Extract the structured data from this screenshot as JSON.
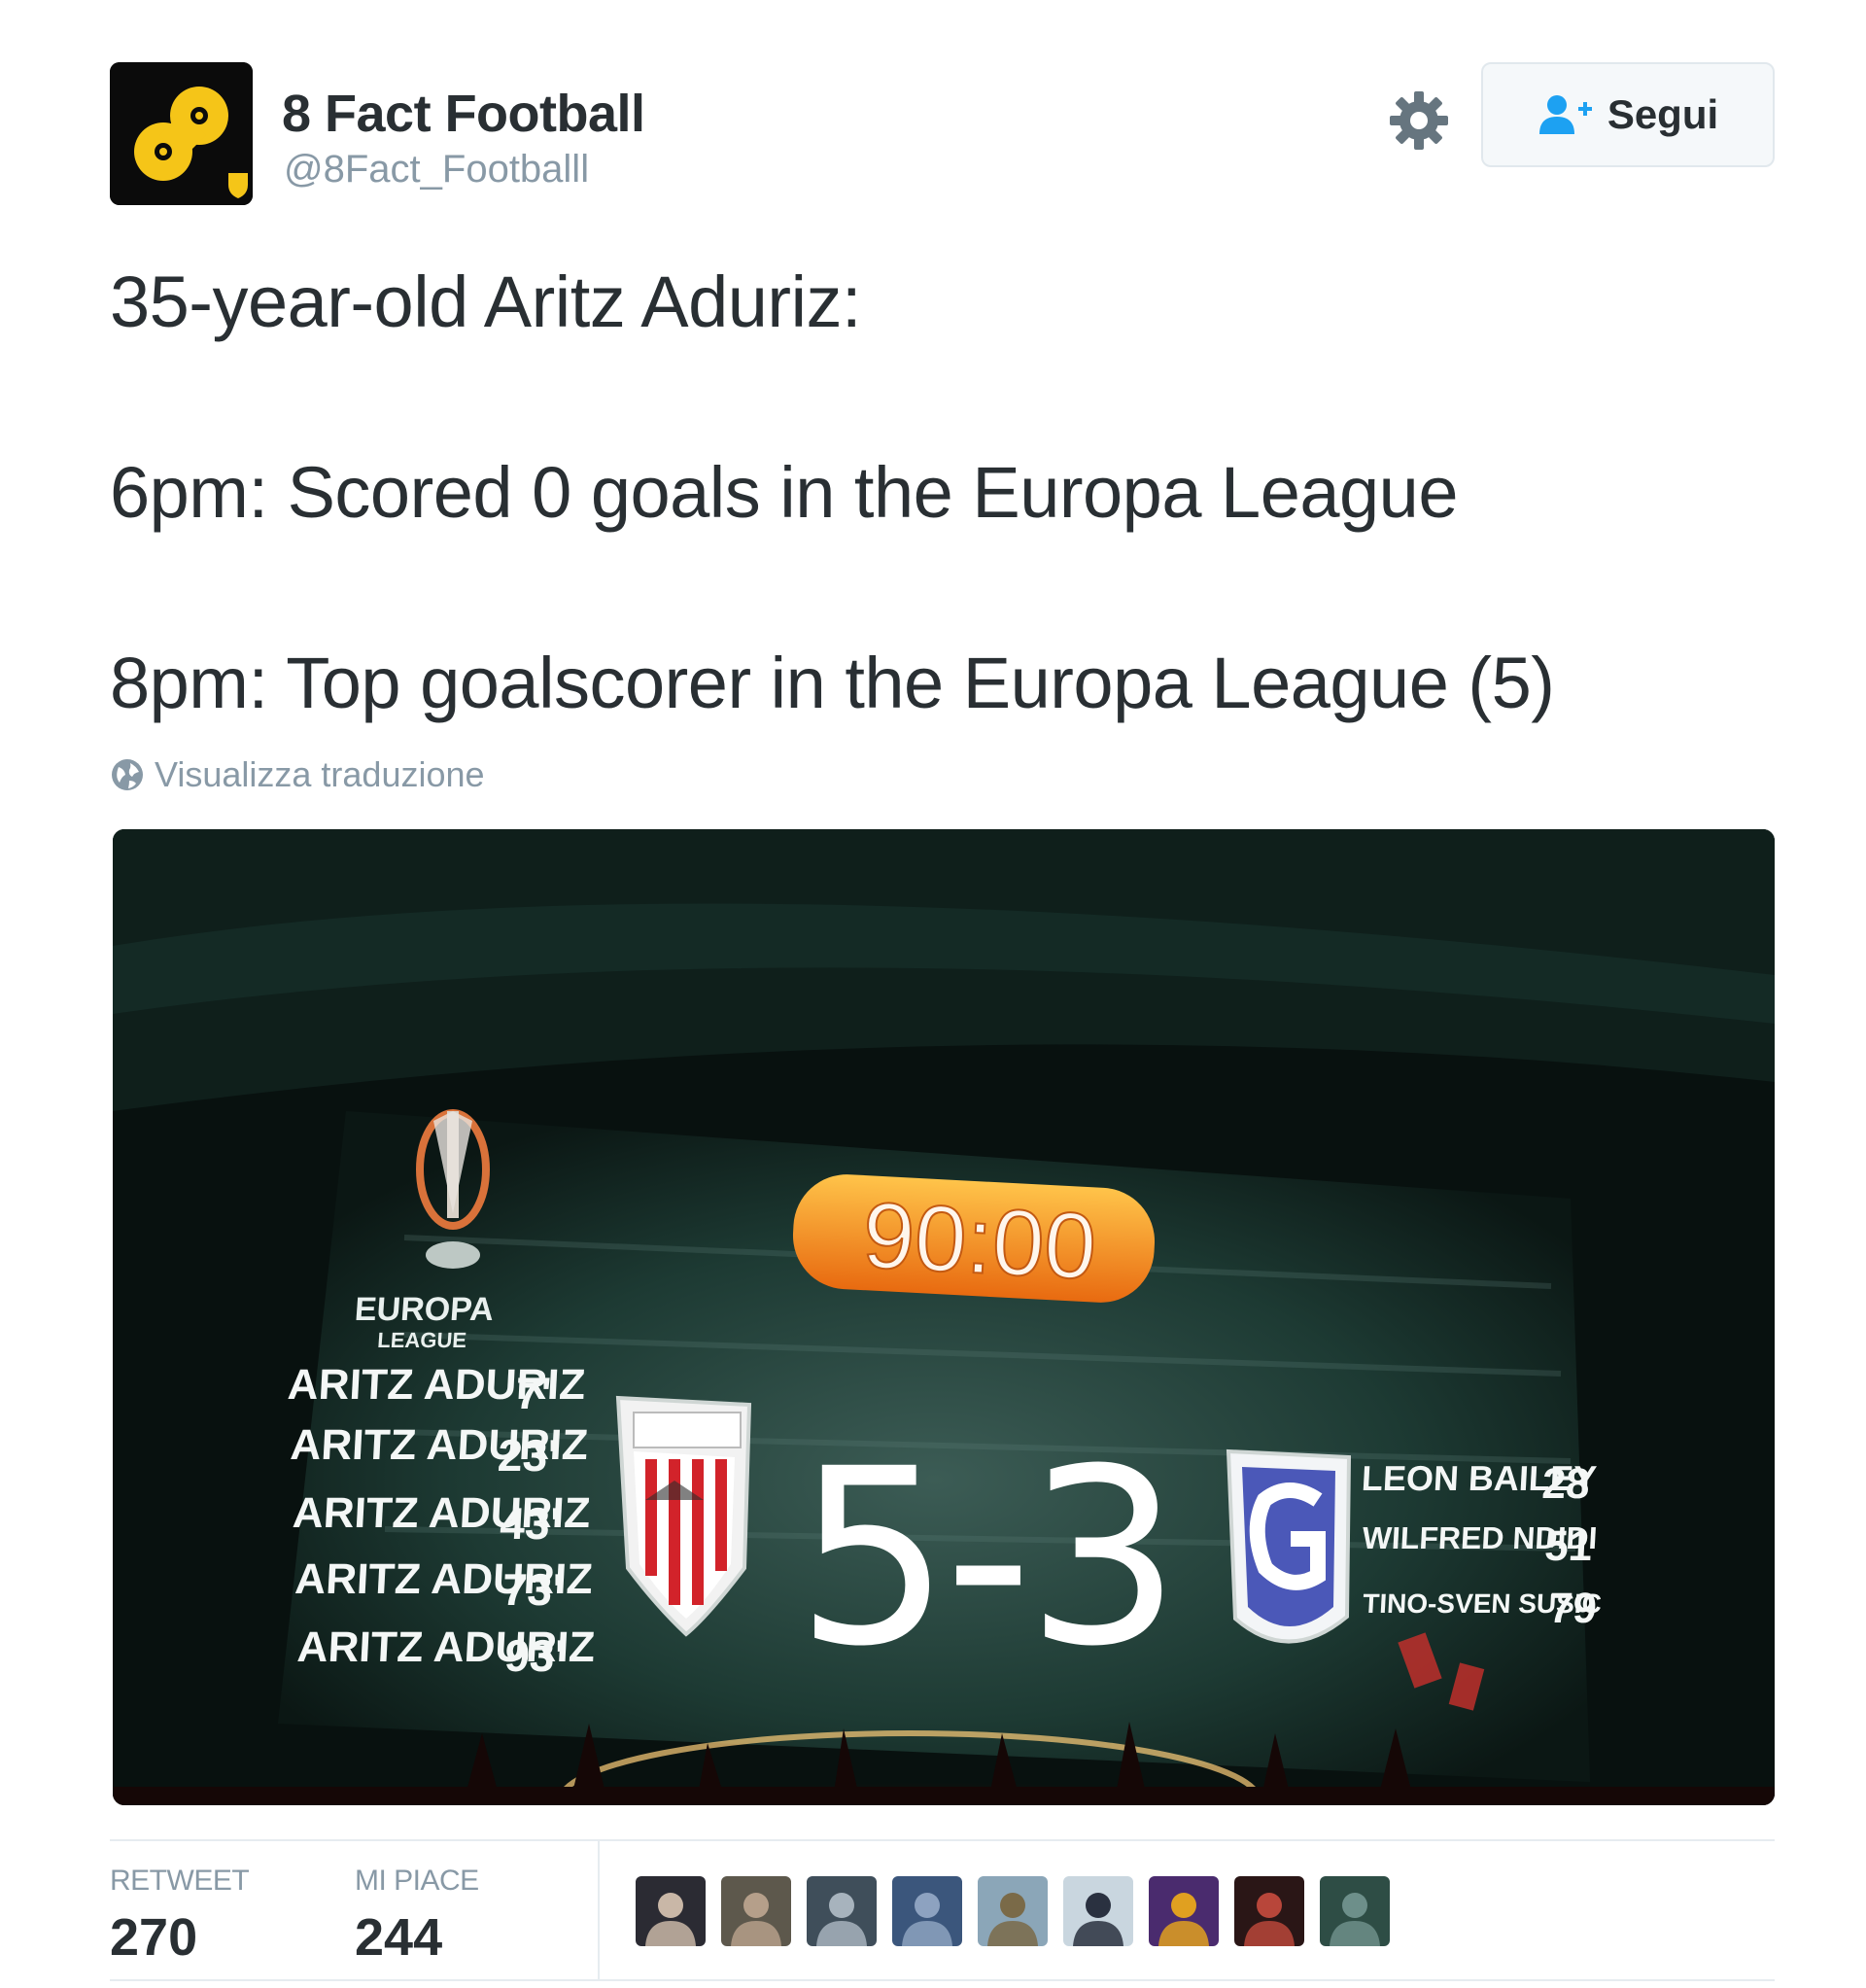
{
  "account": {
    "name": "8 Fact Football",
    "handle": "@8Fact_Footballl",
    "follow_label": "Segui",
    "avatar_colors": {
      "background": "#0b0b0b",
      "logo": "#f5c518"
    }
  },
  "tweet": {
    "lines": [
      "35-year-old Aritz Aduriz:",
      "6pm: Scored 0 goals in the Europa League",
      "8pm: Top goalscorer in the Europa League (5)"
    ],
    "translate_label": "Visualizza traduzione"
  },
  "media": {
    "clock": "90:00",
    "score": "5-3",
    "competition_lines": [
      "EUROPA",
      "LEAGUE"
    ],
    "home_scorers": [
      {
        "name": "ARITZ ADURIZ",
        "minute": "7'"
      },
      {
        "name": "ARITZ ADURIZ",
        "minute": "23'"
      },
      {
        "name": "ARITZ ADURIZ",
        "minute": "43'"
      },
      {
        "name": "ARITZ ADURIZ",
        "minute": "73'"
      },
      {
        "name": "ARITZ ADURIZ",
        "minute": "93'"
      }
    ],
    "away_scorers": [
      {
        "name": "LEON BAILEY",
        "minute": "28"
      },
      {
        "name": "WILFRED NDIDI",
        "minute": "51"
      },
      {
        "name": "TINO-SVEN SUSIC",
        "minute": "79"
      }
    ],
    "colors": {
      "clock_orange": "#f07a1c",
      "board_bg": "#1d3a33",
      "flames": "#ff6a1a"
    }
  },
  "stats": {
    "retweet_label": "RETWEET",
    "retweet_count": "270",
    "like_label": "MI PIACE",
    "like_count": "244"
  },
  "likers": [
    {
      "color_a": "#2b2b33",
      "color_b": "#c9b7a7"
    },
    {
      "color_a": "#5d584c",
      "color_b": "#b59f8a"
    },
    {
      "color_a": "#3f4e5a",
      "color_b": "#a7b3bd"
    },
    {
      "color_a": "#3b567c",
      "color_b": "#8da2c0"
    },
    {
      "color_a": "#8ba6b8",
      "color_b": "#7a6a48"
    },
    {
      "color_a": "#c9d6df",
      "color_b": "#2a3140"
    },
    {
      "color_a": "#4a2b6e",
      "color_b": "#e0a020"
    },
    {
      "color_a": "#2a1616",
      "color_b": "#b8463a"
    },
    {
      "color_a": "#2e4d45",
      "color_b": "#6d8f8a"
    }
  ]
}
